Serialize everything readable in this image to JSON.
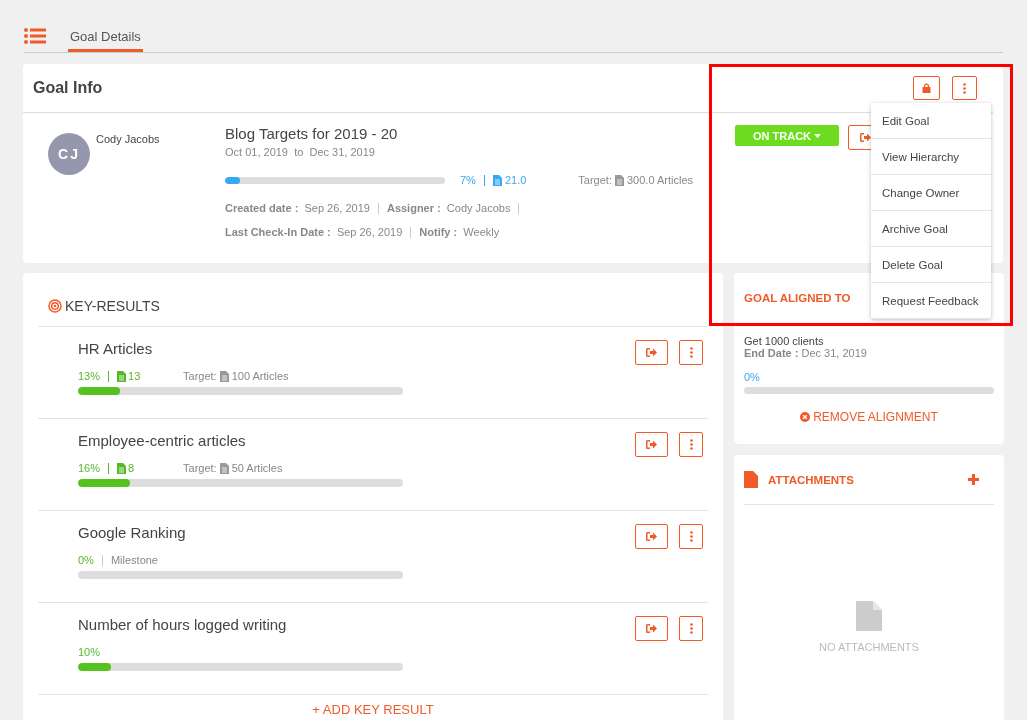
{
  "tabs": [
    {
      "label": "Goal Details",
      "selected": true
    }
  ],
  "goal_info": {
    "title": "Goal Info",
    "owner": {
      "initials": "CJ",
      "name": "Cody Jacobs"
    },
    "goal": {
      "name": "Blog Targets for 2019 - 20",
      "start": "Oct 01, 2019",
      "to": "to",
      "end": "Dec 31, 2019",
      "percent": "7%",
      "level": 0.07,
      "count": "21.0",
      "target_label": "Target:",
      "target": "300.0 Articles",
      "meta": [
        {
          "label": "Created date :",
          "value": "Sep 26, 2019"
        },
        {
          "label": "Assigner :",
          "value": "Cody Jacobs"
        }
      ],
      "meta2": [
        {
          "label": "Last Check-In Date :",
          "value": "Sep 26, 2019"
        },
        {
          "label": "Notify :",
          "value": "Weekly"
        }
      ]
    },
    "status": "ON TRACK"
  },
  "menu": [
    {
      "label": "Edit Goal"
    },
    {
      "label": "View Hierarchy"
    },
    {
      "label": "Change Owner"
    },
    {
      "label": "Archive Goal"
    },
    {
      "label": "Delete Goal"
    },
    {
      "label": "Request Feedback"
    }
  ],
  "key_results": {
    "title": "KEY-RESULTS",
    "items": [
      {
        "kind": "count",
        "name": "HR Articles",
        "percent": "13%",
        "count": "13",
        "target_label": "Target:",
        "target": "100 Articles",
        "level": 0.13
      },
      {
        "kind": "count",
        "name": "Employee-centric articles",
        "percent": "16%",
        "count": "8",
        "target_label": "Target:",
        "target": "50 Articles",
        "level": 0.16
      },
      {
        "kind": "milestone",
        "name": "Google Ranking",
        "percent": "0%",
        "note": "Milestone",
        "level": 0
      },
      {
        "kind": "plain",
        "name": "Number of hours logged writing",
        "percent": "10%",
        "level": 0.1
      }
    ],
    "add": "+ ADD KEY RESULT"
  },
  "aligned": {
    "title": "GOAL ALIGNED TO",
    "goal": "Get 1000 clients",
    "end_label": "End Date :",
    "end": "Dec 31, 2019",
    "percent": "0%",
    "remove": "REMOVE ALIGNMENT"
  },
  "attachments": {
    "title": "ATTACHMENTS",
    "empty": "NO ATTACHMENTS"
  }
}
